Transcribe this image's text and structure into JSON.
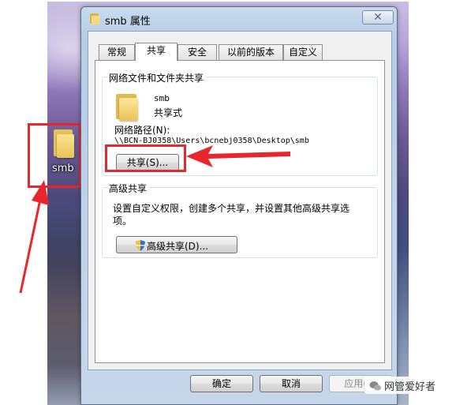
{
  "desktop": {
    "folder_label": "smb"
  },
  "dialog": {
    "title": "smb 属性",
    "close_glyph": "✕",
    "tabs": [
      {
        "label": "常规",
        "active": false
      },
      {
        "label": "共享",
        "active": true
      },
      {
        "label": "安全",
        "active": false
      },
      {
        "label": "以前的版本",
        "active": false
      },
      {
        "label": "自定义",
        "active": false
      }
    ],
    "network_sharing": {
      "group_title": "网络文件和文件夹共享",
      "folder_name": "smb",
      "share_status": "共享式",
      "path_label": "网络路径(N):",
      "path_value": "\\\\BCN-BJ0358\\Users\\bcnebj0358\\Desktop\\smb",
      "share_button": "共享(S)..."
    },
    "advanced_sharing": {
      "group_title": "高级共享",
      "description_line1": "设置自定义权限，创建多个共享，并设置其他高级共享选",
      "description_line2": "项。",
      "advanced_button": "高级共享(D)..."
    },
    "footer": {
      "ok_button": "确定",
      "cancel_button": "取消",
      "apply_button": "应用(A)"
    }
  },
  "watermark": {
    "text": "网管爱好者"
  },
  "colors": {
    "highlight_red": "#e8262b",
    "folder_yellow": "#f6da7c"
  }
}
